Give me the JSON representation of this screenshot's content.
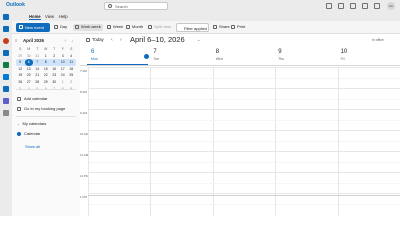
{
  "titlebar": {
    "app_title": "Outlook",
    "search_placeholder": "Search",
    "avatar_initials": "AC"
  },
  "ribbon": {
    "tabs": [
      "Home",
      "View",
      "Help"
    ],
    "active_tab": "Home",
    "new_event_label": "New event",
    "day_label": "Day",
    "work_week_label": "Work week",
    "week_label": "Week",
    "month_label": "Month",
    "split_view_label": "Split view",
    "filter_label": "Filter applied",
    "share_label": "Share",
    "print_label": "Print"
  },
  "mini_calendar": {
    "title": "April 2026",
    "weekday_headers": [
      "S",
      "M",
      "T",
      "W",
      "T",
      "F",
      "S"
    ],
    "weeks": [
      [
        "29",
        "30",
        "31",
        "1",
        "2",
        "3",
        "4"
      ],
      [
        "5",
        "6",
        "7",
        "8",
        "9",
        "10",
        "11"
      ],
      [
        "12",
        "13",
        "14",
        "15",
        "16",
        "17",
        "18"
      ],
      [
        "19",
        "20",
        "21",
        "22",
        "23",
        "24",
        "25"
      ],
      [
        "26",
        "27",
        "28",
        "29",
        "30",
        "1",
        "2"
      ],
      [
        "3",
        "4",
        "5",
        "6",
        "7",
        "8",
        "9"
      ]
    ],
    "today": "6"
  },
  "left_pane": {
    "add_calendar": "Add calendar",
    "booking_page": "Go to my booking page",
    "my_calendars": "My calendars",
    "calendar_item": "Calendar",
    "show_all": "Show all"
  },
  "calendar": {
    "today_label": "Today",
    "range_title": "April 6–10, 2026",
    "timezone_label": "In office",
    "days": [
      {
        "num": "6",
        "name": "Mon"
      },
      {
        "num": "7",
        "name": "Tue"
      },
      {
        "num": "8",
        "name": "Wed"
      },
      {
        "num": "9",
        "name": "Thu"
      },
      {
        "num": "10",
        "name": "Fri"
      }
    ],
    "hours": [
      "7 AM",
      "8 AM",
      "9 AM",
      "10 AM",
      "11 AM",
      "12 PM",
      "1 PM"
    ]
  },
  "colors": {
    "accent": "#0f6cbd",
    "rail_bg": "#ebebeb"
  }
}
